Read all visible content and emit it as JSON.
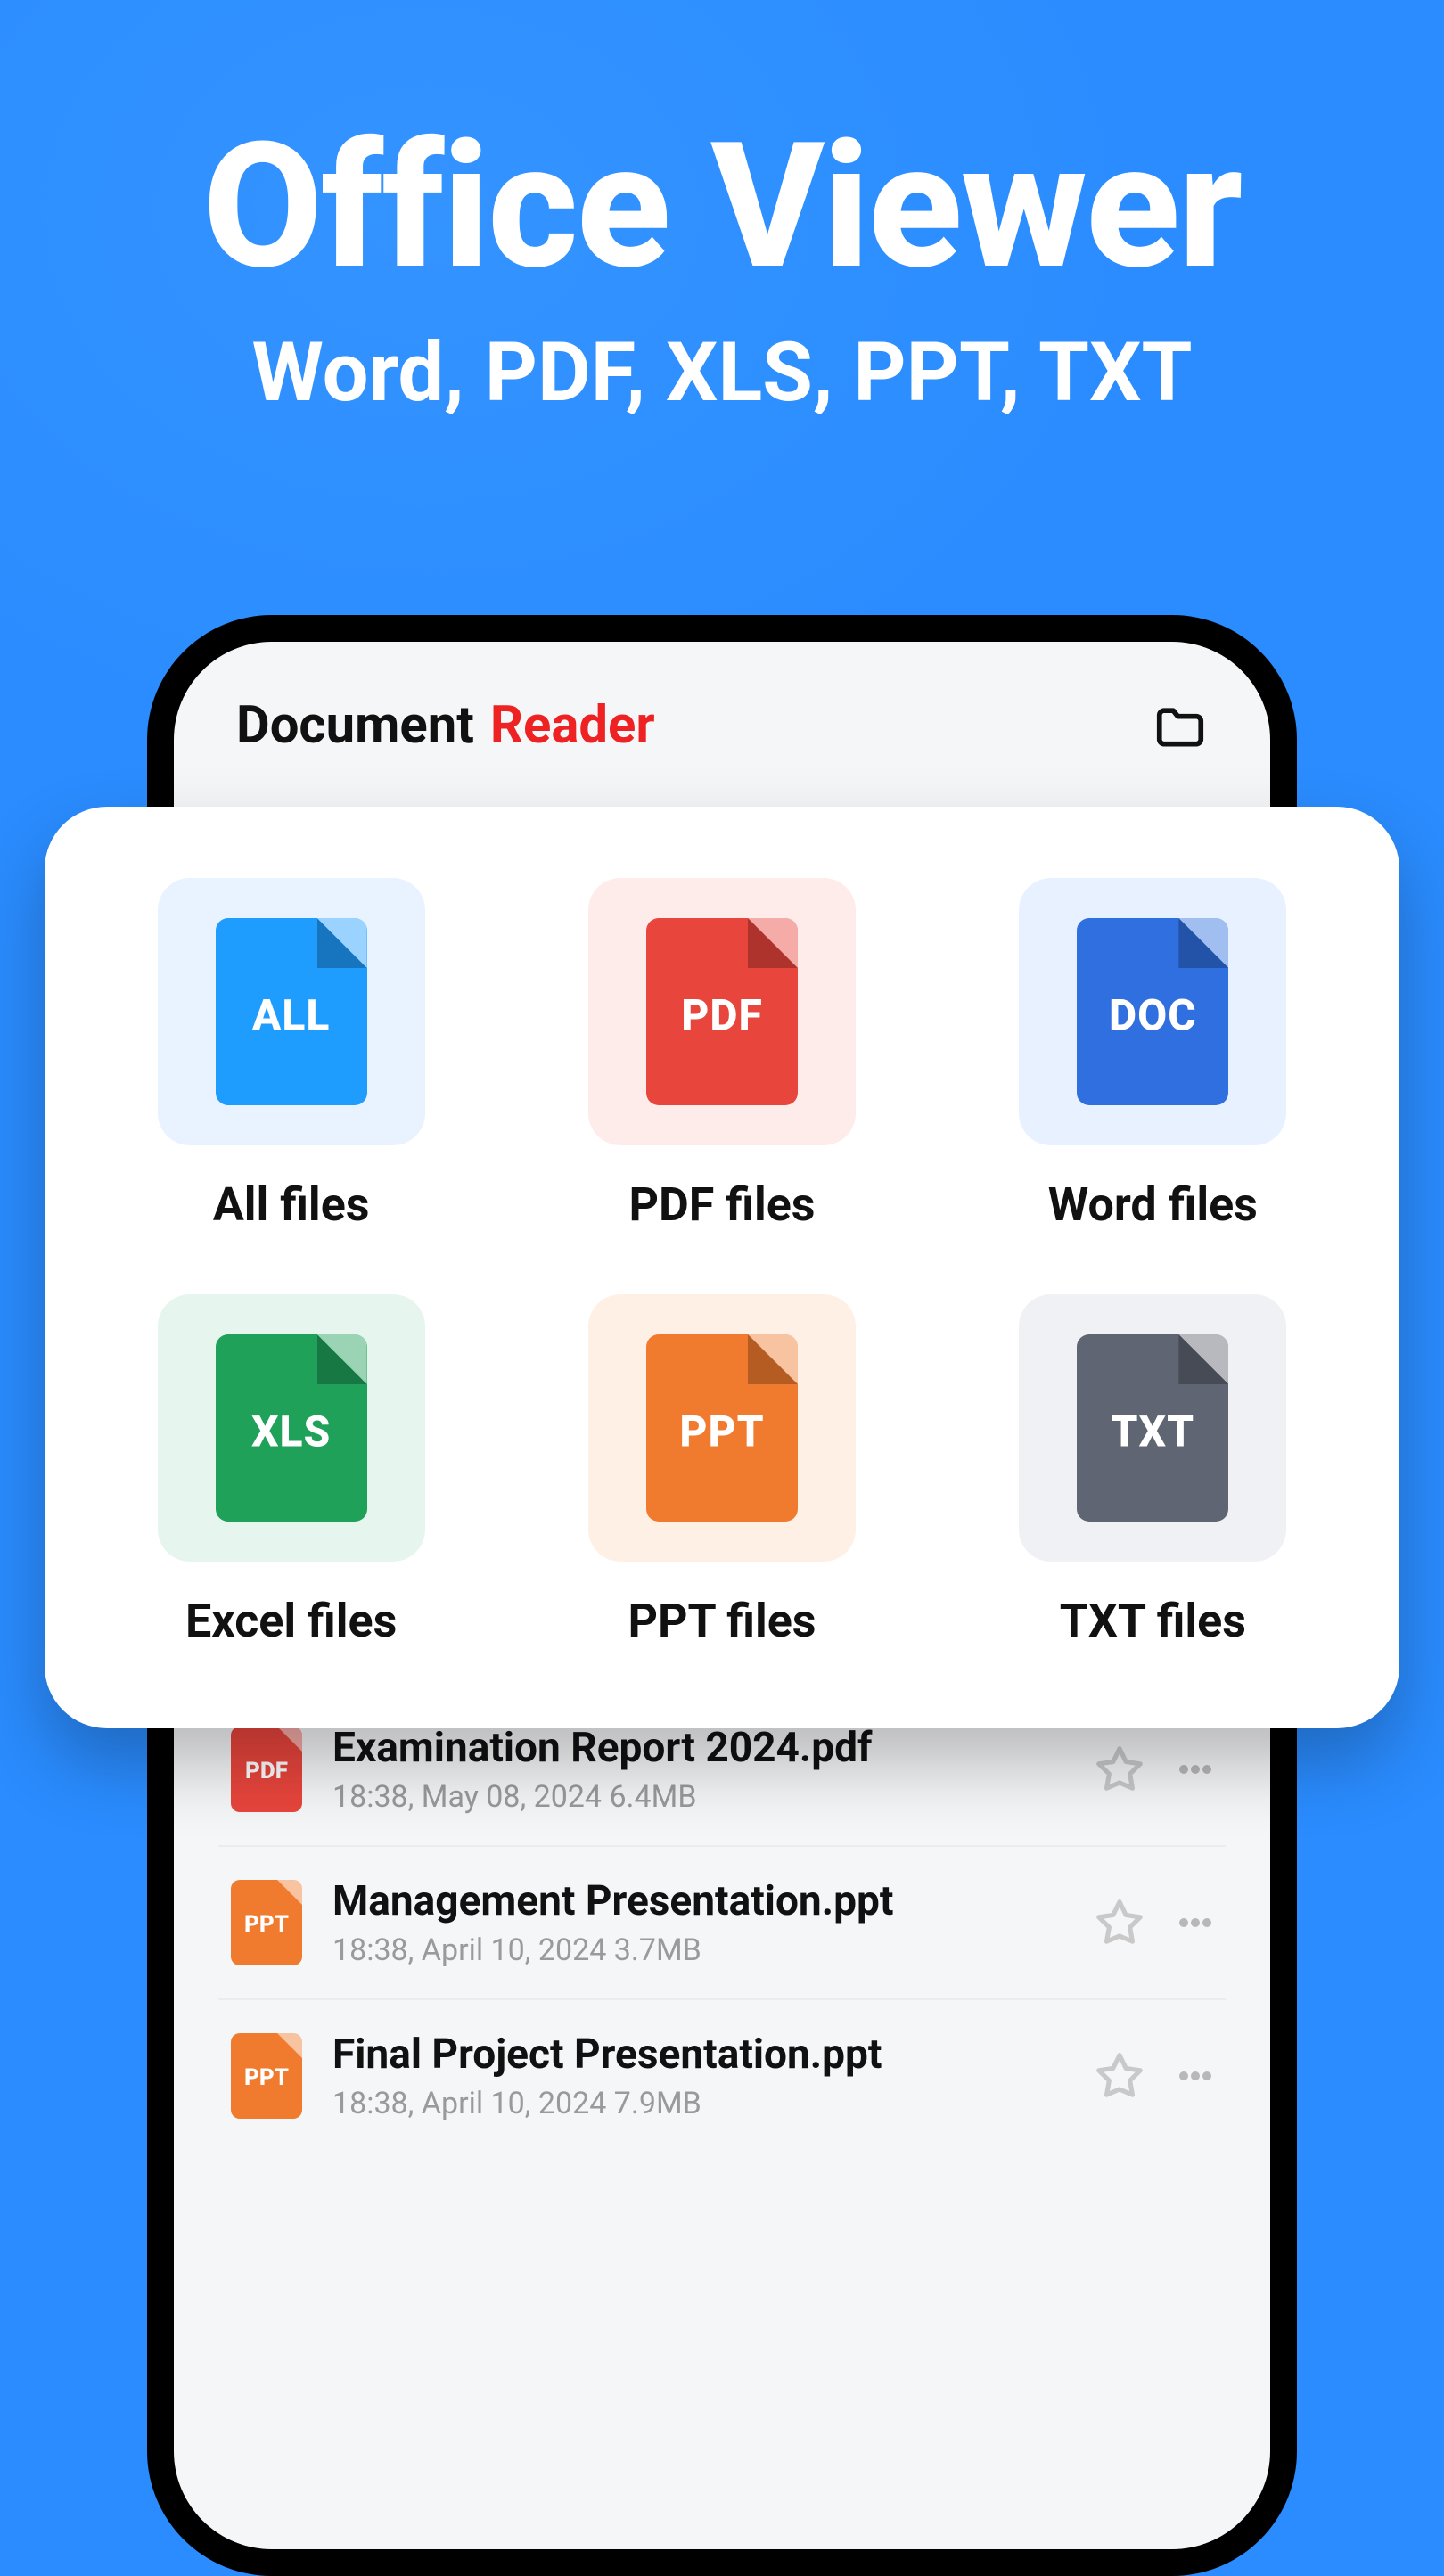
{
  "hero": {
    "title": "Office Viewer",
    "subtitle": "Word, PDF, XLS, PPT, TXT"
  },
  "app": {
    "title1": "Document",
    "title2": "Reader"
  },
  "types": {
    "all": {
      "tag": "ALL",
      "label": "All files"
    },
    "pdf": {
      "tag": "PDF",
      "label": "PDF files"
    },
    "doc": {
      "tag": "DOC",
      "label": "Word files"
    },
    "xls": {
      "tag": "XLS",
      "label": "Excel files"
    },
    "ppt": {
      "tag": "PPT",
      "label": "PPT files"
    },
    "txt": {
      "tag": "TXT",
      "label": "TXT files"
    }
  },
  "files": [
    {
      "type": "PDF",
      "color": "#e8453c",
      "name": "Examination Report 2024.pdf",
      "time": "18:38, May 08, 2024",
      "size": "6.4MB"
    },
    {
      "type": "PPT",
      "color": "#f07b2e",
      "name": "Management Presentation.ppt",
      "time": "18:38, April 10, 2024",
      "size": "3.7MB"
    },
    {
      "type": "PPT",
      "color": "#f07b2e",
      "name": "Final Project Presentation.ppt",
      "time": "18:38, April 10, 2024",
      "size": "7.9MB"
    }
  ]
}
